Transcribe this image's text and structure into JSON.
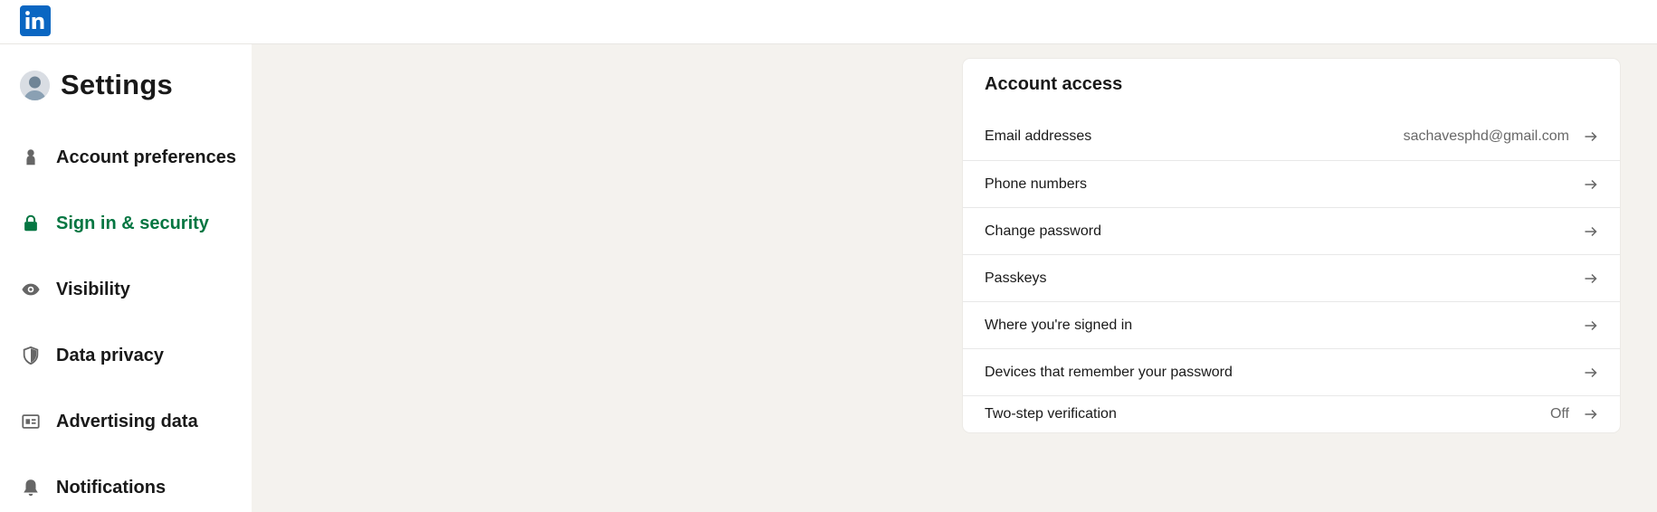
{
  "app": {
    "logo_icon": "linkedin-logo",
    "brand_color": "#0a66c2",
    "active_color": "#057642"
  },
  "sidebar": {
    "title": "Settings",
    "items": [
      {
        "label": "Account preferences",
        "icon": "person-icon"
      },
      {
        "label": "Sign in & security",
        "icon": "lock-icon",
        "active": true
      },
      {
        "label": "Visibility",
        "icon": "eye-icon"
      },
      {
        "label": "Data privacy",
        "icon": "shield-icon"
      },
      {
        "label": "Advertising data",
        "icon": "ad-card-icon"
      },
      {
        "label": "Notifications",
        "icon": "bell-icon"
      }
    ]
  },
  "account_access": {
    "title": "Account access",
    "rows": [
      {
        "label": "Email addresses",
        "value": "sachavesphd@gmail.com"
      },
      {
        "label": "Phone numbers",
        "value": ""
      },
      {
        "label": "Change password",
        "value": ""
      },
      {
        "label": "Passkeys",
        "value": ""
      },
      {
        "label": "Where you're signed in",
        "value": ""
      },
      {
        "label": "Devices that remember your password",
        "value": ""
      },
      {
        "label": "Two-step verification",
        "value": "Off"
      }
    ]
  }
}
